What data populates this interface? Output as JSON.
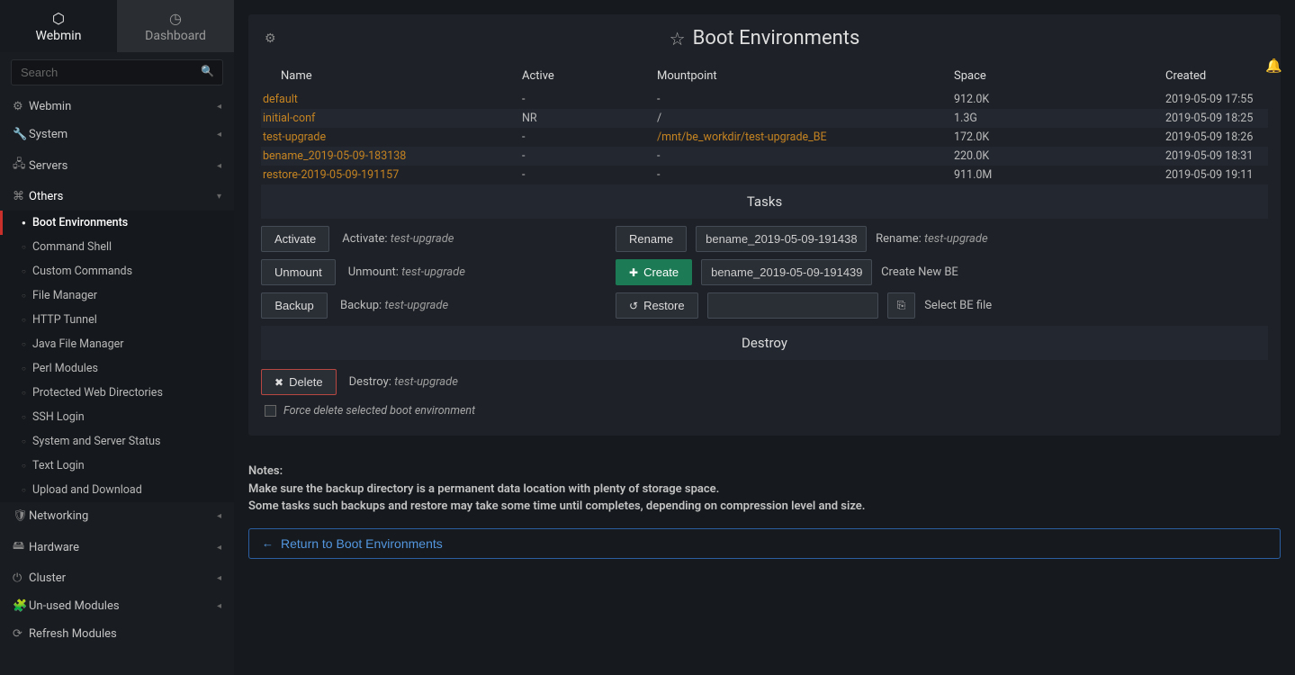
{
  "tabs": {
    "webmin": "Webmin",
    "dashboard": "Dashboard"
  },
  "search": {
    "placeholder": "Search"
  },
  "nav": {
    "groups": [
      {
        "icon": "⚙",
        "label": "Webmin"
      },
      {
        "icon": "🔧",
        "label": "System"
      },
      {
        "icon": "🖧",
        "label": "Servers"
      }
    ],
    "others": {
      "icon": "⌘",
      "label": "Others"
    },
    "subitems": [
      "Boot Environments",
      "Command Shell",
      "Custom Commands",
      "File Manager",
      "HTTP Tunnel",
      "Java File Manager",
      "Perl Modules",
      "Protected Web Directories",
      "SSH Login",
      "System and Server Status",
      "Text Login",
      "Upload and Download"
    ],
    "groups2": [
      {
        "icon": "🛡",
        "label": "Networking"
      },
      {
        "icon": "🖴",
        "label": "Hardware"
      },
      {
        "icon": "⏻",
        "label": "Cluster"
      },
      {
        "icon": "🧩",
        "label": "Un-used Modules"
      },
      {
        "icon": "⟳",
        "label": "Refresh Modules"
      }
    ]
  },
  "page": {
    "title": "Boot Environments"
  },
  "table": {
    "headers": {
      "name": "Name",
      "active": "Active",
      "mount": "Mountpoint",
      "space": "Space",
      "created": "Created"
    },
    "rows": [
      {
        "name": "default",
        "active": "-",
        "mount": "-",
        "mountlink": false,
        "space": "912.0K",
        "created": "2019-05-09 17:55"
      },
      {
        "name": "initial-conf",
        "active": "NR",
        "mount": "/",
        "mountlink": false,
        "space": "1.3G",
        "created": "2019-05-09 18:25"
      },
      {
        "name": "test-upgrade",
        "active": "-",
        "mount": "/mnt/be_workdir/test-upgrade_BE",
        "mountlink": true,
        "space": "172.0K",
        "created": "2019-05-09 18:26"
      },
      {
        "name": "bename_2019-05-09-183138",
        "active": "-",
        "mount": "-",
        "mountlink": false,
        "space": "220.0K",
        "created": "2019-05-09 18:31"
      },
      {
        "name": "restore-2019-05-09-191157",
        "active": "-",
        "mount": "-",
        "mountlink": false,
        "space": "911.0M",
        "created": "2019-05-09 19:11"
      }
    ]
  },
  "tasks": {
    "title": "Tasks",
    "activate": {
      "btn": "Activate",
      "label": "Activate:",
      "target": "test-upgrade"
    },
    "unmount": {
      "btn": "Unmount",
      "label": "Unmount:",
      "target": "test-upgrade"
    },
    "backup": {
      "btn": "Backup",
      "label": "Backup:",
      "target": "test-upgrade"
    },
    "rename": {
      "btn": "Rename",
      "value": "bename_2019-05-09-191438",
      "label": "Rename:",
      "target": "test-upgrade"
    },
    "create": {
      "btn": "Create",
      "value": "bename_2019-05-09-191439",
      "label": "Create New BE"
    },
    "restore": {
      "btn": "Restore",
      "label": "Select BE file"
    }
  },
  "destroy": {
    "title": "Destroy",
    "delete": {
      "btn": "Delete",
      "label": "Destroy:",
      "target": "test-upgrade"
    },
    "force": "Force delete selected boot environment"
  },
  "notes": {
    "heading": "Notes:",
    "line1": "Make sure the backup directory is a permanent data location with plenty of storage space.",
    "line2": "Some tasks such backups and restore may take some time until completes, depending on compression level and size."
  },
  "return": {
    "label": "Return to Boot Environments"
  }
}
